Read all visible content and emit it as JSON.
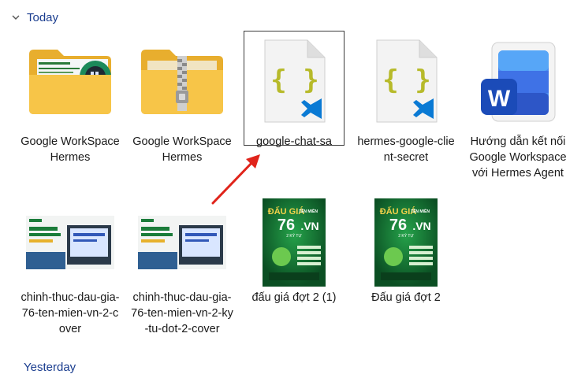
{
  "groups": {
    "today": "Today",
    "yesterday": "Yesterday"
  },
  "files": [
    {
      "name": "Google WorkSpace Hermes",
      "icon": "folder-preview-icon"
    },
    {
      "name": "Google WorkSpace Hermes",
      "icon": "zip-folder-icon"
    },
    {
      "name": "google-chat-sa",
      "icon": "json-file-icon",
      "selected": true
    },
    {
      "name": "hermes-google-client-secret",
      "icon": "json-file-icon"
    },
    {
      "name": "Hướng dẫn kết nối Google Workspace với Hermes Agent",
      "icon": "word-document-icon"
    },
    {
      "name": "chinh-thuc-dau-gia-76-ten-mien-vn-2-cover",
      "icon": "image-thumbnail-icon"
    },
    {
      "name": "chinh-thuc-dau-gia-76-ten-mien-vn-2-ky-tu-dot-2-cover",
      "icon": "image-thumbnail-icon"
    },
    {
      "name": "đấu giá đợt 2 (1)",
      "icon": "poster-thumbnail-icon"
    },
    {
      "name": "Đấu giá đợt 2",
      "icon": "poster-thumbnail-icon"
    }
  ],
  "thumb_text": {
    "poster_headline": "ĐẤU GIÁ",
    "poster_sub": "TÊN MIỀN",
    "poster_number": "76",
    "poster_vn": ".VN",
    "poster_tag": "2 KÝ TỰ",
    "word_letter": "W"
  },
  "colors": {
    "group_title": "#1a3d8f",
    "folder": "#f5c243",
    "vscode": "#0a7ad4",
    "json_brace": "#b7ba2a",
    "poster_green": "#0f6b2f",
    "arrow": "#e0241b"
  }
}
